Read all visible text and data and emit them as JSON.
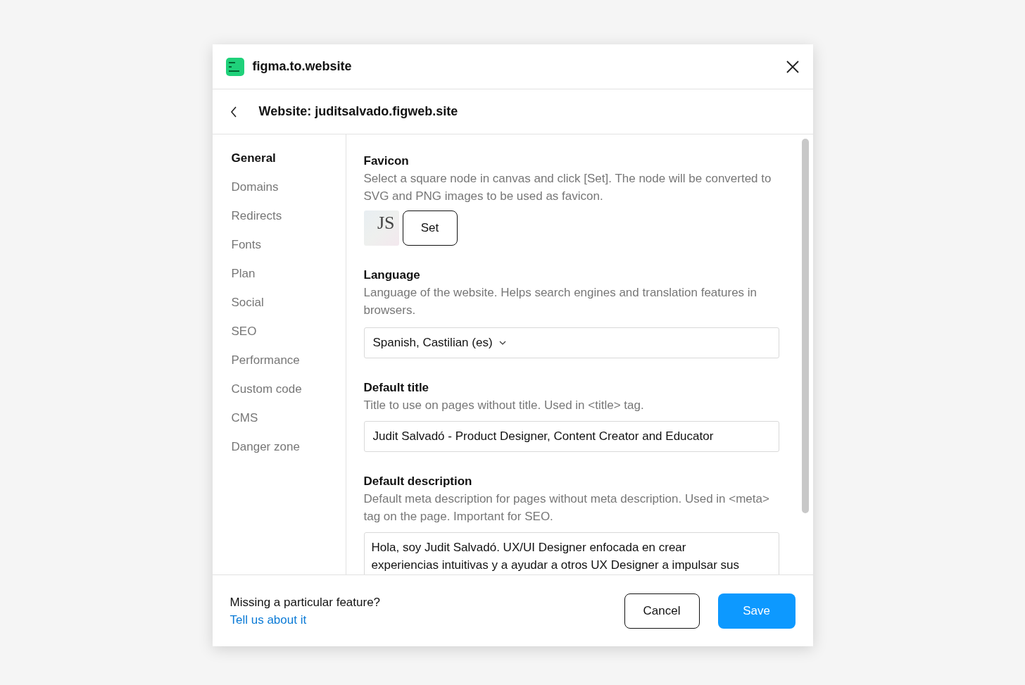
{
  "app": {
    "title": "figma.to.website"
  },
  "subheader": {
    "title": "Website: juditsalvado.figweb.site"
  },
  "sidebar": {
    "items": [
      {
        "label": "General",
        "selected": true
      },
      {
        "label": "Domains",
        "selected": false
      },
      {
        "label": "Redirects",
        "selected": false
      },
      {
        "label": "Fonts",
        "selected": false
      },
      {
        "label": "Plan",
        "selected": false
      },
      {
        "label": "Social",
        "selected": false
      },
      {
        "label": "SEO",
        "selected": false
      },
      {
        "label": "Performance",
        "selected": false
      },
      {
        "label": "Custom code",
        "selected": false
      },
      {
        "label": "CMS",
        "selected": false
      },
      {
        "label": "Danger zone",
        "selected": false
      }
    ]
  },
  "sections": [
    {
      "kind": "favicon",
      "title": "Favicon",
      "description": "Select a square node in canvas and click [Set]. The node will be converted to SVG and PNG images to be used as favicon.",
      "preview_text": "JS",
      "button": "Set"
    },
    {
      "kind": "select",
      "title": "Language",
      "description": "Language of the website. Helps search engines and translation features in browsers.",
      "value": "Spanish, Castilian (es)"
    },
    {
      "kind": "input",
      "title": "Default title",
      "description": "Title to use on pages without title. Used in <title> tag.",
      "value": "Judit Salvadó - Product Designer, Content Creator and Educator"
    },
    {
      "kind": "textarea",
      "title": "Default description",
      "description": "Default meta description for pages without meta description. Used in <meta> tag on the page. Important for SEO.",
      "lines": [
        "Hola, soy Judit Salvadó. UX/UI Designer enfocada en crear",
        "experiencias intuitivas y a ayudar a otros UX Designer a impulsar sus"
      ]
    }
  ],
  "footer": {
    "text": "Missing a particular feature?",
    "link": "Tell us about it",
    "buttons": [
      {
        "label": "Cancel",
        "kind": "secondary"
      },
      {
        "label": "Save",
        "kind": "primary"
      }
    ]
  }
}
